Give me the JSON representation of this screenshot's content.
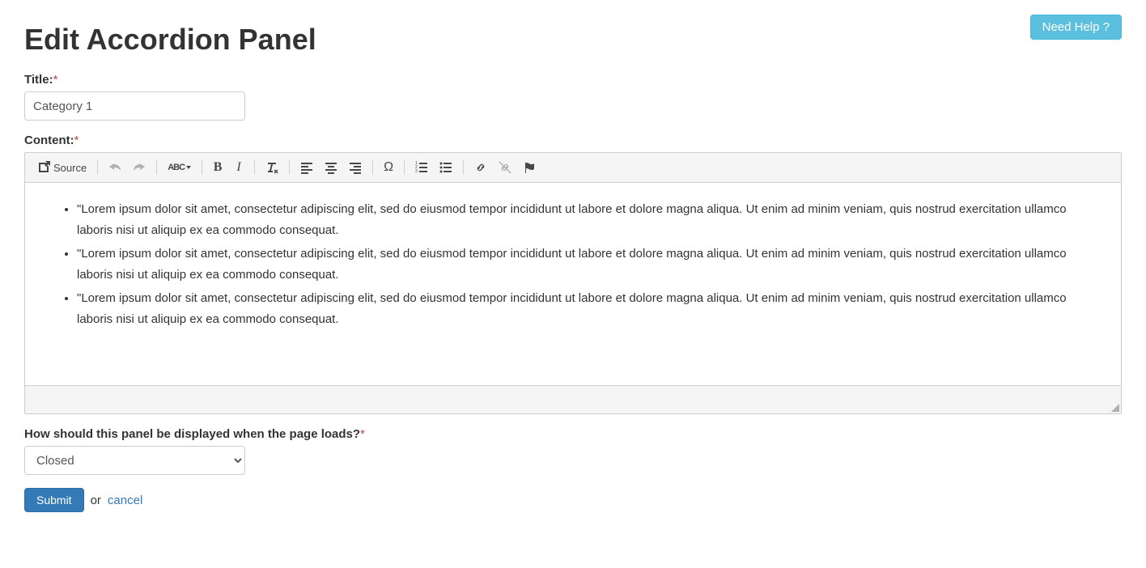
{
  "header": {
    "title": "Edit Accordion Panel",
    "help_label": "Need Help ?"
  },
  "fields": {
    "title_label": "Title:",
    "title_value": "Category 1",
    "content_label": "Content:",
    "display_label": "How should this panel be displayed when the page loads?",
    "display_value": "Closed"
  },
  "toolbar": {
    "source_label": "Source"
  },
  "content_items": [
    "\"Lorem ipsum dolor sit amet, consectetur adipiscing elit, sed do eiusmod tempor incididunt ut labore et dolore magna aliqua. Ut enim ad minim veniam, quis nostrud exercitation ullamco laboris nisi ut aliquip ex ea commodo consequat.",
    "\"Lorem ipsum dolor sit amet, consectetur adipiscing elit, sed do eiusmod tempor incididunt ut labore et dolore magna aliqua. Ut enim ad minim veniam, quis nostrud exercitation ullamco laboris nisi ut aliquip ex ea commodo consequat.",
    "\"Lorem ipsum dolor sit amet, consectetur adipiscing elit, sed do eiusmod tempor incididunt ut labore et dolore magna aliqua. Ut enim ad minim veniam, quis nostrud exercitation ullamco laboris nisi ut aliquip ex ea commodo consequat."
  ],
  "actions": {
    "submit_label": "Submit",
    "or_text": "or",
    "cancel_label": "cancel"
  },
  "required_marker": "*"
}
